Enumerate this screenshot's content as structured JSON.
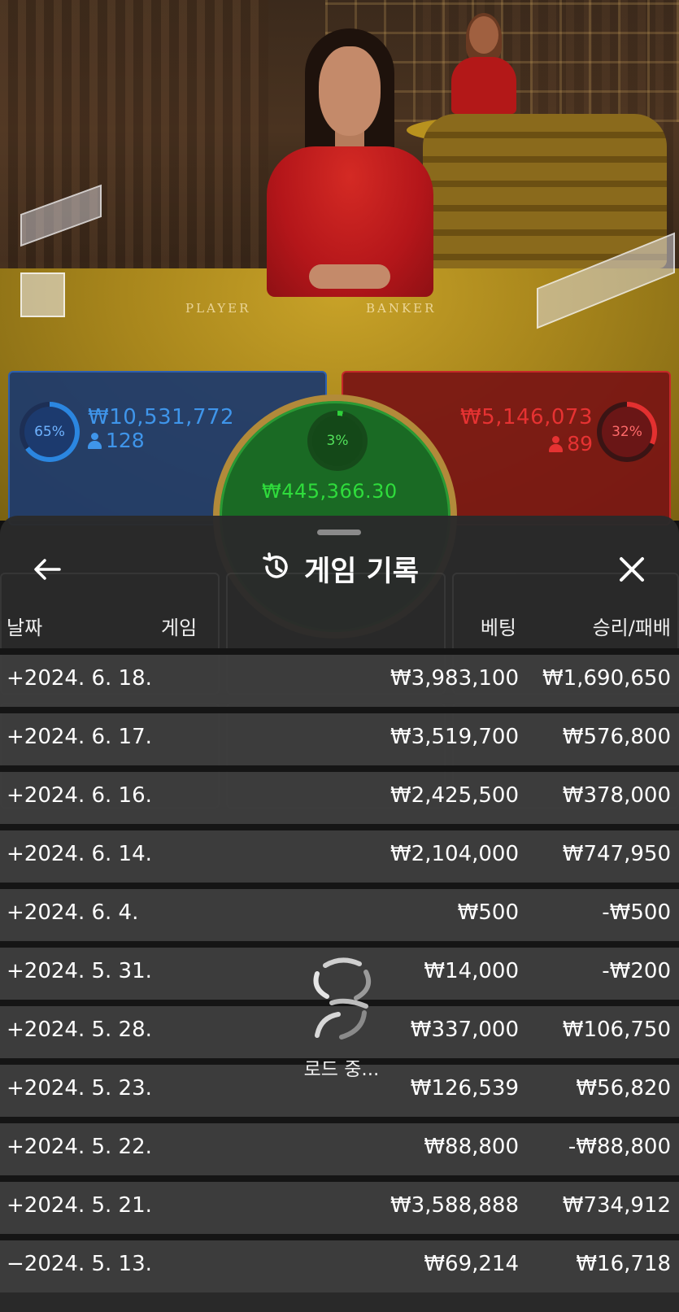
{
  "scene": {
    "player_label": "PLAYER",
    "banker_label": "BANKER"
  },
  "bets": {
    "player": {
      "percent": "65%",
      "amount": "₩10,531,772",
      "count": "128",
      "color": "#2b86e0"
    },
    "banker": {
      "percent": "32%",
      "amount": "₩5,146,073",
      "count": "89",
      "color": "#e33030"
    },
    "tie": {
      "percent": "3%",
      "amount": "₩445,366.30",
      "color": "#2fd03a"
    }
  },
  "sheet": {
    "title": "게임 기록",
    "icons": {
      "back": "arrow-left-icon",
      "history": "history-icon",
      "close": "close-icon"
    },
    "columns": {
      "date": "날짜",
      "game": "게임",
      "bet": "베팅",
      "result": "승리/패배"
    },
    "rows": [
      {
        "date": "+2024. 6. 18.",
        "bet": "₩3,983,100",
        "result": "₩1,690,650"
      },
      {
        "date": "+2024. 6. 17.",
        "bet": "₩3,519,700",
        "result": "₩576,800"
      },
      {
        "date": "+2024. 6. 16.",
        "bet": "₩2,425,500",
        "result": "₩378,000"
      },
      {
        "date": "+2024. 6. 14.",
        "bet": "₩2,104,000",
        "result": "₩747,950"
      },
      {
        "date": "+2024. 6. 4.",
        "bet": "₩500",
        "result": "-₩500"
      },
      {
        "date": "+2024. 5. 31.",
        "bet": "₩14,000",
        "result": "-₩200"
      },
      {
        "date": "+2024. 5. 28.",
        "bet": "₩337,000",
        "result": "₩106,750"
      },
      {
        "date": "+2024. 5. 23.",
        "bet": "₩126,539",
        "result": "₩56,820"
      },
      {
        "date": "+2024. 5. 22.",
        "bet": "₩88,800",
        "result": "-₩88,800"
      },
      {
        "date": "+2024. 5. 21.",
        "bet": "₩3,588,888",
        "result": "₩734,912"
      },
      {
        "date": "−2024. 5. 13.",
        "bet": "₩69,214",
        "result": "₩16,718"
      }
    ],
    "loading_text": "로드 중..."
  }
}
